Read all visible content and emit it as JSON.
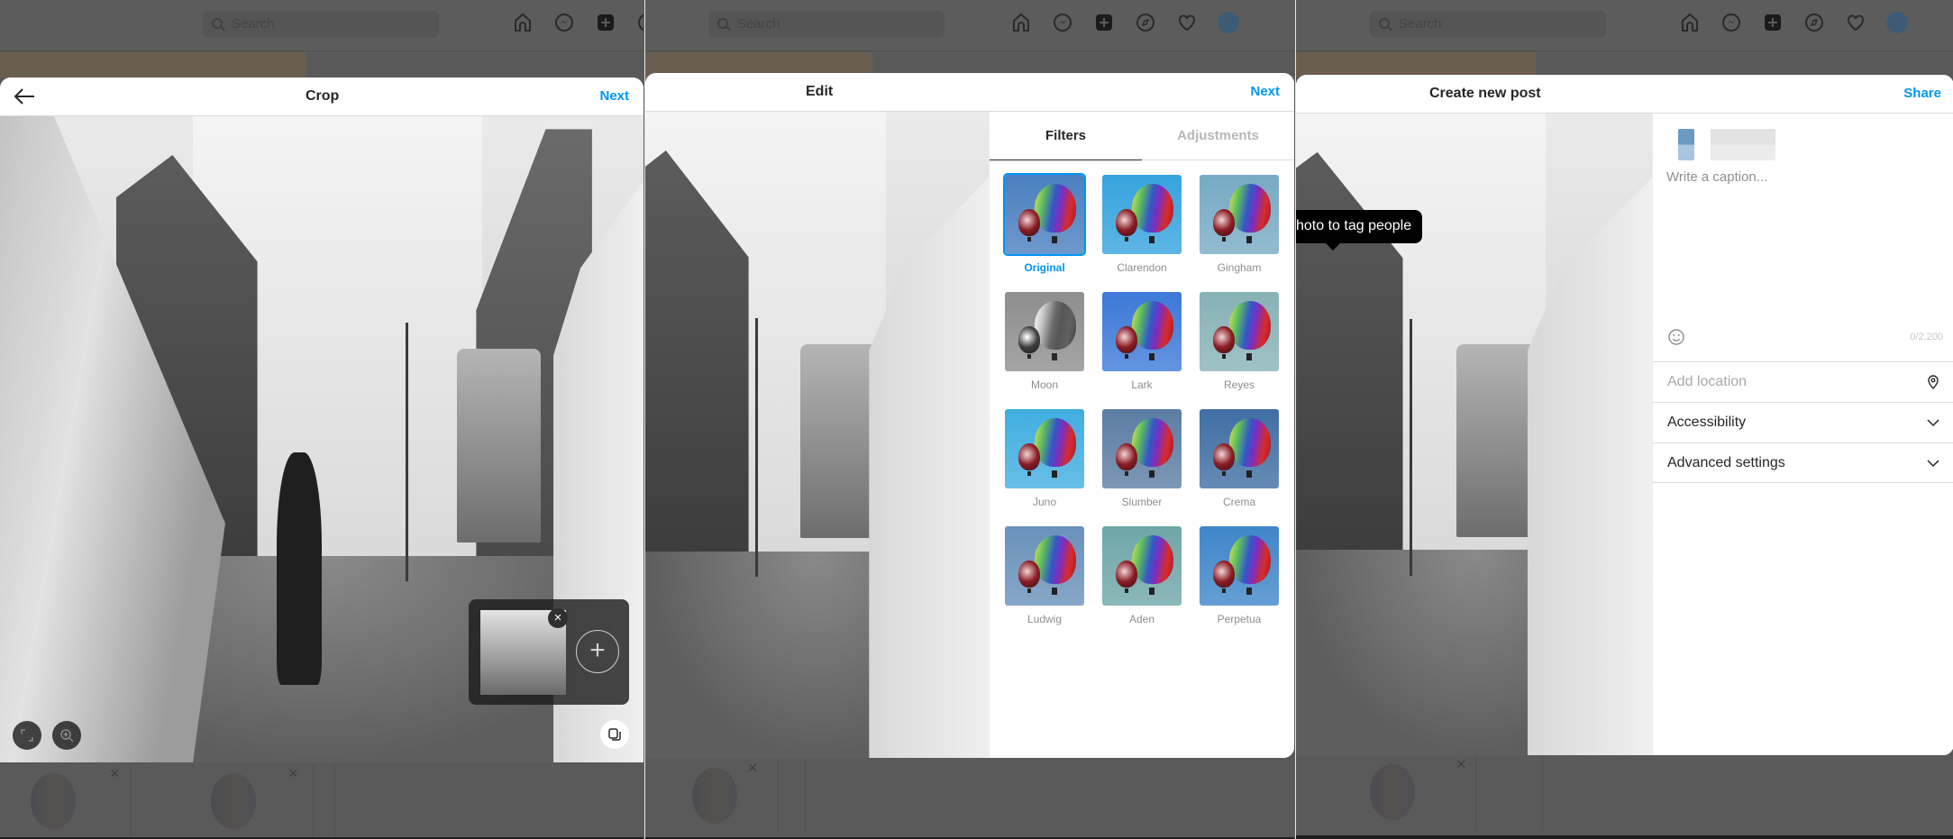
{
  "nav": {
    "search_placeholder": "Search",
    "icons": [
      "home-icon",
      "messenger-icon",
      "new-post-icon",
      "explore-icon",
      "activity-heart-icon",
      "profile-avatar"
    ]
  },
  "crop_panel": {
    "title": "Crop",
    "next_label": "Next",
    "back_icon": "arrow-left-icon",
    "thumb_remove_label": "×",
    "add_media_label": "+",
    "controls": [
      "expand-icon",
      "zoom-icon",
      "multiple-media-icon"
    ]
  },
  "edit_panel": {
    "title": "Edit",
    "next_label": "Next",
    "tabs": [
      {
        "label": "Filters",
        "active": true
      },
      {
        "label": "Adjustments",
        "active": false
      }
    ],
    "filters": [
      {
        "name": "Original",
        "selected": true,
        "tone": "#4a7fbf"
      },
      {
        "name": "Clarendon",
        "selected": false,
        "tone": "#36a3de"
      },
      {
        "name": "Gingham",
        "selected": false,
        "tone": "#77aac4"
      },
      {
        "name": "Moon",
        "selected": false,
        "tone": "#8e8e8e"
      },
      {
        "name": "Lark",
        "selected": false,
        "tone": "#3d79d8"
      },
      {
        "name": "Reyes",
        "selected": false,
        "tone": "#87b2b6"
      },
      {
        "name": "Juno",
        "selected": false,
        "tone": "#41aee0"
      },
      {
        "name": "Slumber",
        "selected": false,
        "tone": "#5c7da3"
      },
      {
        "name": "Crema",
        "selected": false,
        "tone": "#406ea3"
      },
      {
        "name": "Ludwig",
        "selected": false,
        "tone": "#6a91ba"
      },
      {
        "name": "Aden",
        "selected": false,
        "tone": "#6fa6a8"
      },
      {
        "name": "Perpetua",
        "selected": false,
        "tone": "#3f86c9"
      }
    ]
  },
  "create_panel": {
    "title": "Create new post",
    "share_label": "Share",
    "tooltip": "hoto to tag people",
    "caption_placeholder": "Write a caption...",
    "caption_value": "",
    "char_count": "0/2,200",
    "location_placeholder": "Add location",
    "accessibility_label": "Accessibility",
    "advanced_label": "Advanced settings"
  },
  "colors": {
    "accent": "#0095f6",
    "text": "#262626",
    "muted": "#8e8e8e",
    "overlay": "#595959"
  }
}
